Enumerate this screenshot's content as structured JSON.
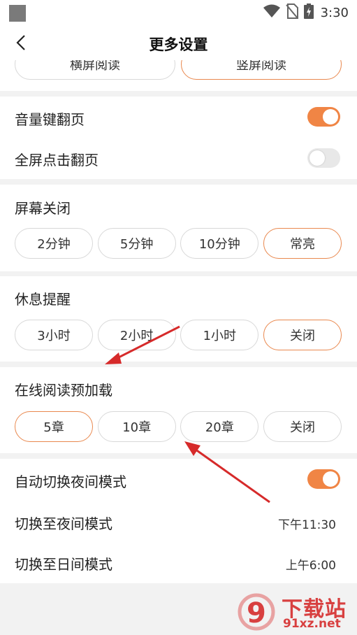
{
  "status_bar": {
    "time": "3:30",
    "icons": [
      "app-square-icon",
      "wifi-icon",
      "no-sim-icon",
      "battery-charging-icon"
    ]
  },
  "header": {
    "title": "更多设置",
    "back_icon": "chevron-left-icon"
  },
  "orientation": {
    "options": [
      {
        "label": "横屏阅读",
        "selected": false
      },
      {
        "label": "竖屏阅读",
        "selected": true
      }
    ]
  },
  "page_turn": {
    "volume_key": {
      "label": "音量键翻页",
      "on": true
    },
    "fullscreen_tap": {
      "label": "全屏点击翻页",
      "on": false
    }
  },
  "screen_off": {
    "title": "屏幕关闭",
    "options": [
      {
        "label": "2分钟",
        "selected": false
      },
      {
        "label": "5分钟",
        "selected": false
      },
      {
        "label": "10分钟",
        "selected": false
      },
      {
        "label": "常亮",
        "selected": true
      }
    ]
  },
  "rest_reminder": {
    "title": "休息提醒",
    "options": [
      {
        "label": "3小时",
        "selected": false
      },
      {
        "label": "2小时",
        "selected": false
      },
      {
        "label": "1小时",
        "selected": false
      },
      {
        "label": "关闭",
        "selected": true
      }
    ]
  },
  "preload": {
    "title": "在线阅读预加载",
    "options": [
      {
        "label": "5章",
        "selected": true
      },
      {
        "label": "10章",
        "selected": false
      },
      {
        "label": "20章",
        "selected": false
      },
      {
        "label": "关闭",
        "selected": false
      }
    ]
  },
  "night_mode": {
    "auto_switch": {
      "label": "自动切换夜间模式",
      "on": true
    },
    "to_night": {
      "label": "切换至夜间模式",
      "value": "下午11:30"
    },
    "to_day": {
      "label": "切换至日间模式",
      "value": "上午6:00"
    }
  },
  "watermark": {
    "logo_text": "9",
    "brand": "下载站",
    "url": "91xz.net"
  },
  "colors": {
    "accent": "#f08545",
    "arrow": "#d62a2a",
    "background": "#f2f2f2"
  }
}
